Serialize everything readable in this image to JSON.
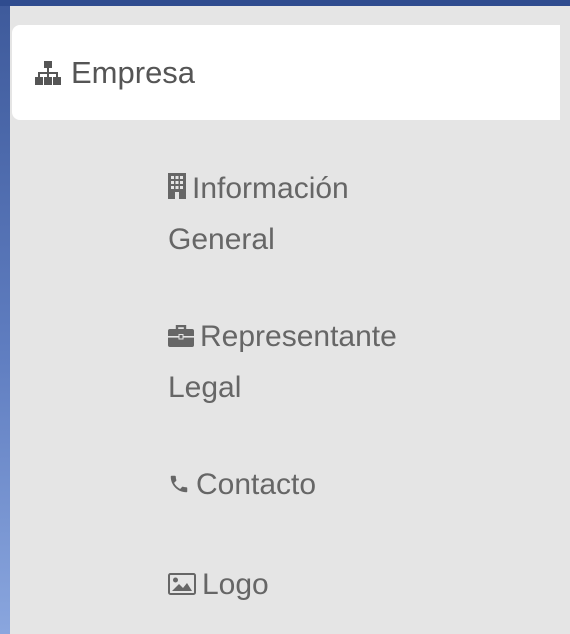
{
  "menu": {
    "header": {
      "label": "Empresa",
      "icon": "sitemap-icon"
    },
    "items": [
      {
        "label_line1": "Información",
        "label_line2": "General",
        "icon": "building-icon"
      },
      {
        "label_line1": "Representante",
        "label_line2": "Legal",
        "icon": "briefcase-icon"
      },
      {
        "label_line1": "Contacto",
        "icon": "phone-icon"
      },
      {
        "label_line1": "Logo",
        "icon": "image-icon"
      }
    ]
  },
  "colors": {
    "panel_bg": "#e5e5e5",
    "header_bg": "#ffffff",
    "text": "#555555",
    "subtext": "#666666",
    "frame_blue": "#3e5a9b"
  }
}
